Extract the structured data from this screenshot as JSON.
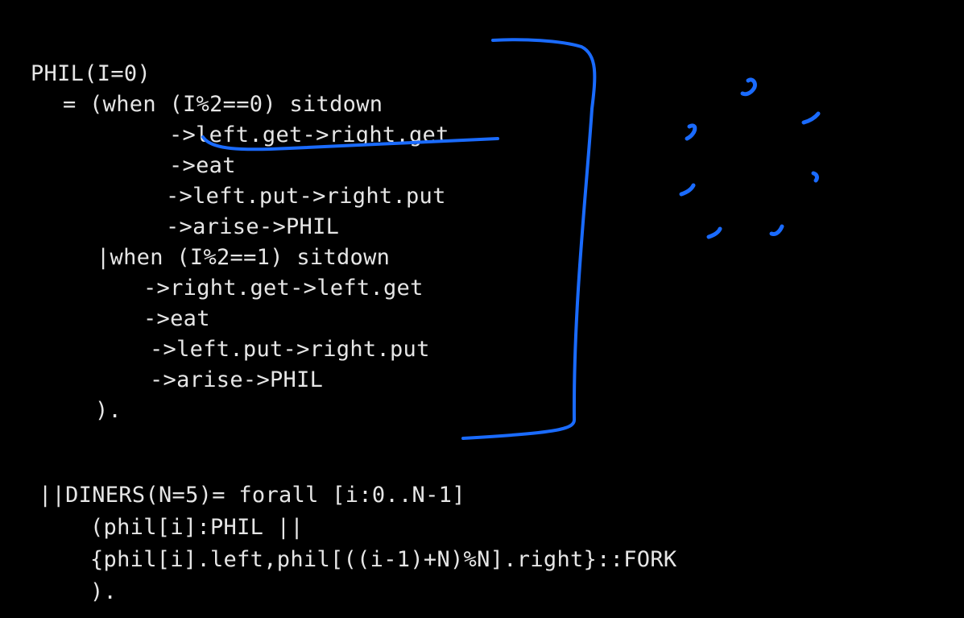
{
  "ink_color": "#1a6bff",
  "process_definition": {
    "lines": [
      "PHIL(I=0)",
      "= (when (I%2==0) sitdown",
      "->left.get->right.get",
      "->eat",
      "->left.put->right.put",
      "->arise->PHIL",
      "|when (I%2==1) sitdown",
      "->right.get->left.get",
      "->eat",
      "->left.put->right.put",
      "->arise->PHIL",
      ")."
    ]
  },
  "composition": {
    "lines": [
      "||DINERS(N=5)= forall [i:0..N-1]",
      "(phil[i]:PHIL ||",
      "{phil[i].left,phil[((i-1)+N)%N].right}::FORK",
      ")."
    ]
  }
}
